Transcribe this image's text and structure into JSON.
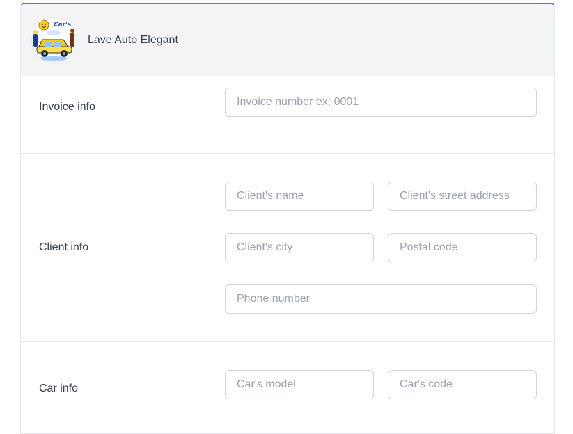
{
  "header": {
    "brand_name": "Lave Auto Elegant",
    "logo_text": "Car's"
  },
  "invoice": {
    "label": "Invoice info",
    "number_placeholder": "Invoice number ex: 0001"
  },
  "client": {
    "label": "Client info",
    "name_placeholder": "Client's name",
    "street_placeholder": "Client's street address",
    "city_placeholder": "Client's city",
    "postal_placeholder": "Postal code",
    "phone_placeholder": "Phone number"
  },
  "car": {
    "label": "Car info",
    "model_placeholder": "Car's model",
    "code_placeholder": "Car's code"
  },
  "colors": {
    "accent": "#3b82f6",
    "header_bg": "#f3f4f6",
    "text": "#374151",
    "placeholder": "#9ca3af",
    "border": "#d1d5db"
  }
}
